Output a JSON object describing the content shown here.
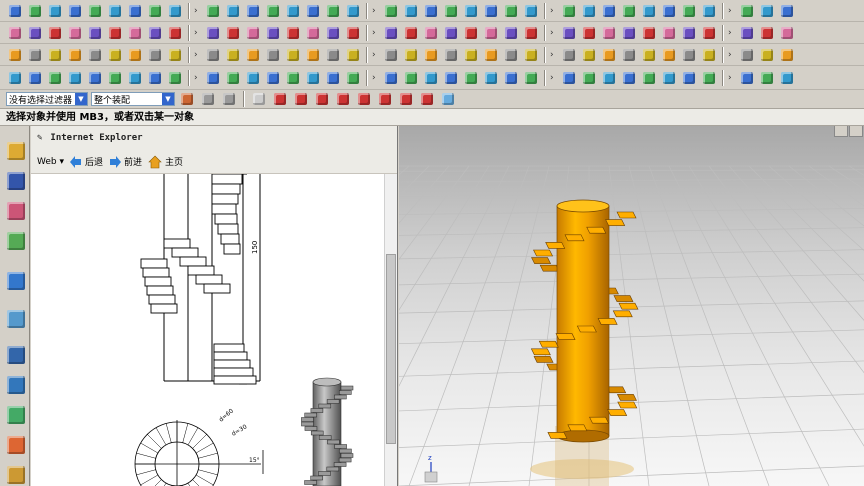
{
  "selection_bar": {
    "filter_value": "没有选择过滤器",
    "assembly_value": "整个装配"
  },
  "status": {
    "message": "选择对象并使用 MB3，或者双击某一对象"
  },
  "browser": {
    "title": "Internet Explorer",
    "web_label": "Web",
    "back_label": "后退",
    "forward_label": "前进",
    "home_label": "主页"
  },
  "drawing": {
    "dim_height": "150",
    "dim_d1": "d=60",
    "dim_d2": "d=30",
    "dim_angle": "15°"
  },
  "colors": {
    "model_orange": "#f0a000",
    "toolbar_bg": "#d4d0c8",
    "viewport_top": "#a8a8a8",
    "viewport_bottom": "#f7f7f7"
  }
}
